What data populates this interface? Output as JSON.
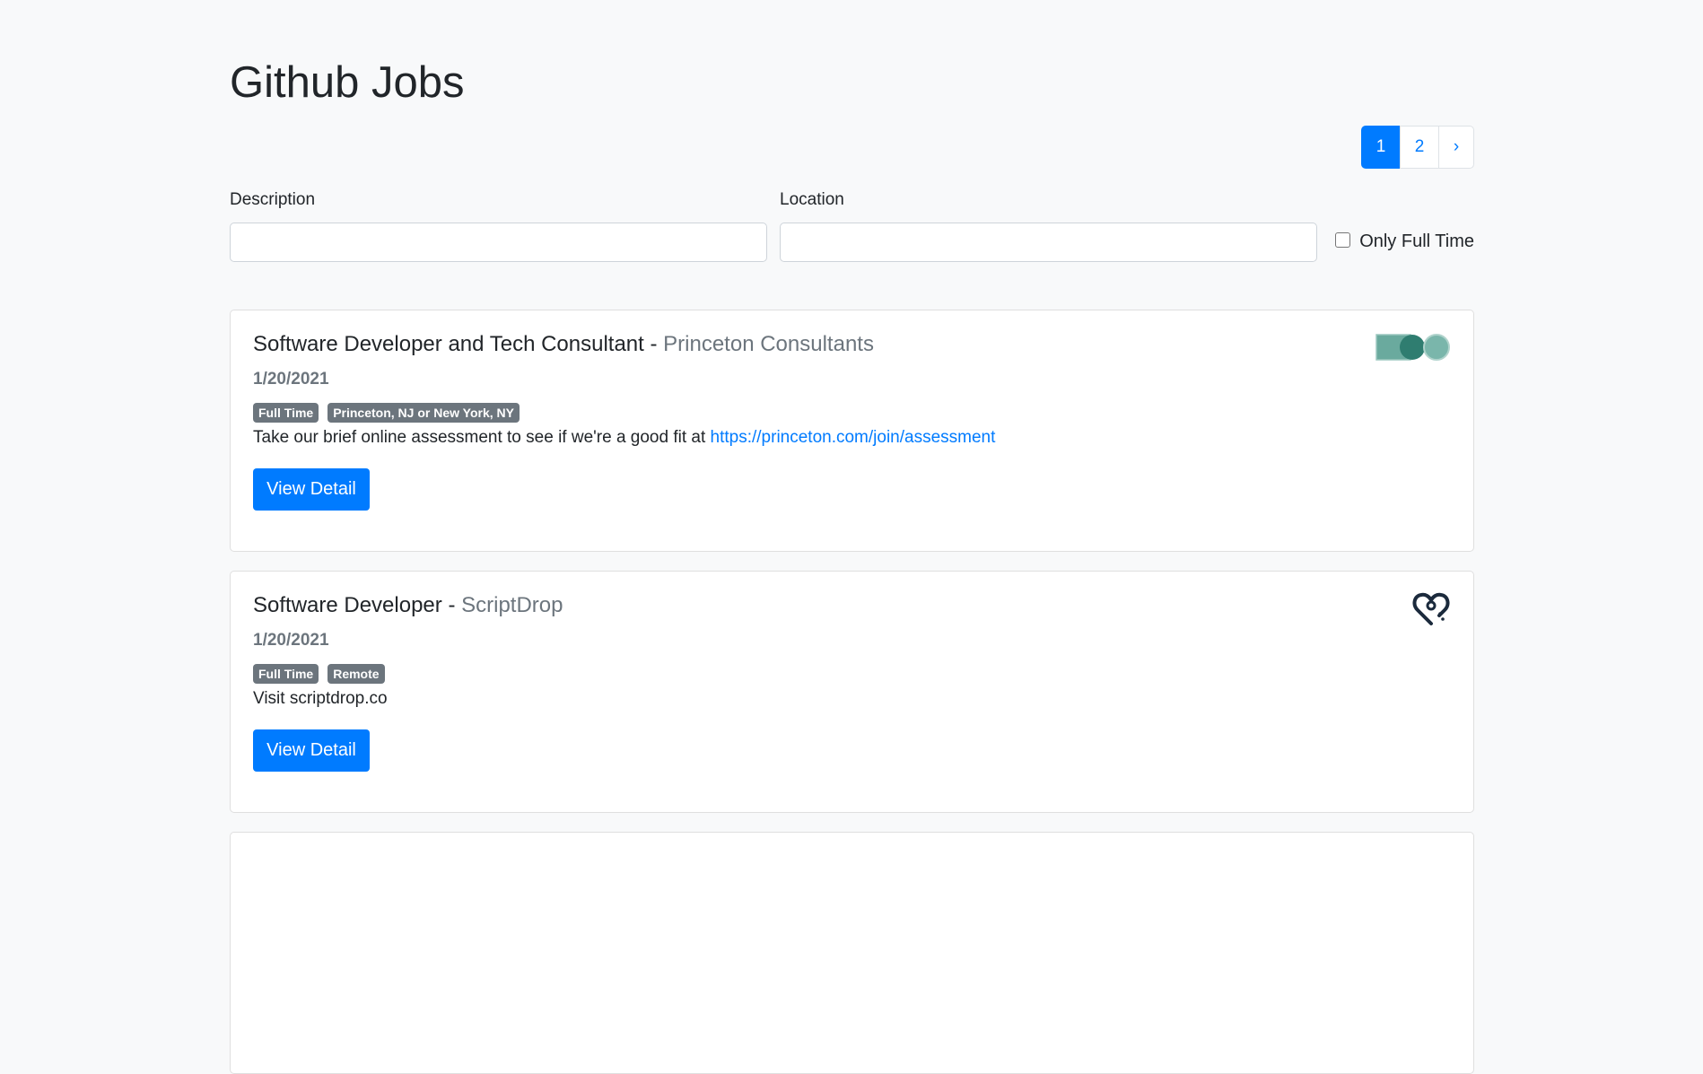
{
  "page": {
    "title": "Github Jobs"
  },
  "pagination": {
    "pages": [
      "1",
      "2"
    ],
    "next": "›",
    "active": "1"
  },
  "filters": {
    "description_label": "Description",
    "description_value": "",
    "location_label": "Location",
    "location_value": "",
    "full_time_label": "Only Full Time",
    "full_time_checked": false
  },
  "jobs": [
    {
      "title": "Software Developer and Tech Consultant",
      "separator": " - ",
      "company": "Princeton Consultants",
      "date": "1/20/2021",
      "badges": [
        "Full Time",
        "Princeton, NJ or New York, NY"
      ],
      "description": "Take our brief online assessment to see if we're a good fit at ",
      "link": "https://princeton.com/join/assessment",
      "button": "View Detail",
      "logo_icon": "princeton-consultants-logo",
      "logo_color": "#5fa99b"
    },
    {
      "title": "Software Developer",
      "separator": " - ",
      "company": "ScriptDrop",
      "date": "1/20/2021",
      "badges": [
        "Full Time",
        "Remote"
      ],
      "description": "Visit scriptdrop.co",
      "link": "",
      "button": "View Detail",
      "logo_icon": "scriptdrop-heart-logo",
      "logo_color": "#1b2a3c"
    }
  ],
  "colors": {
    "primary": "#007bff",
    "badge": "#6c757d",
    "background": "#f8f9fa"
  }
}
